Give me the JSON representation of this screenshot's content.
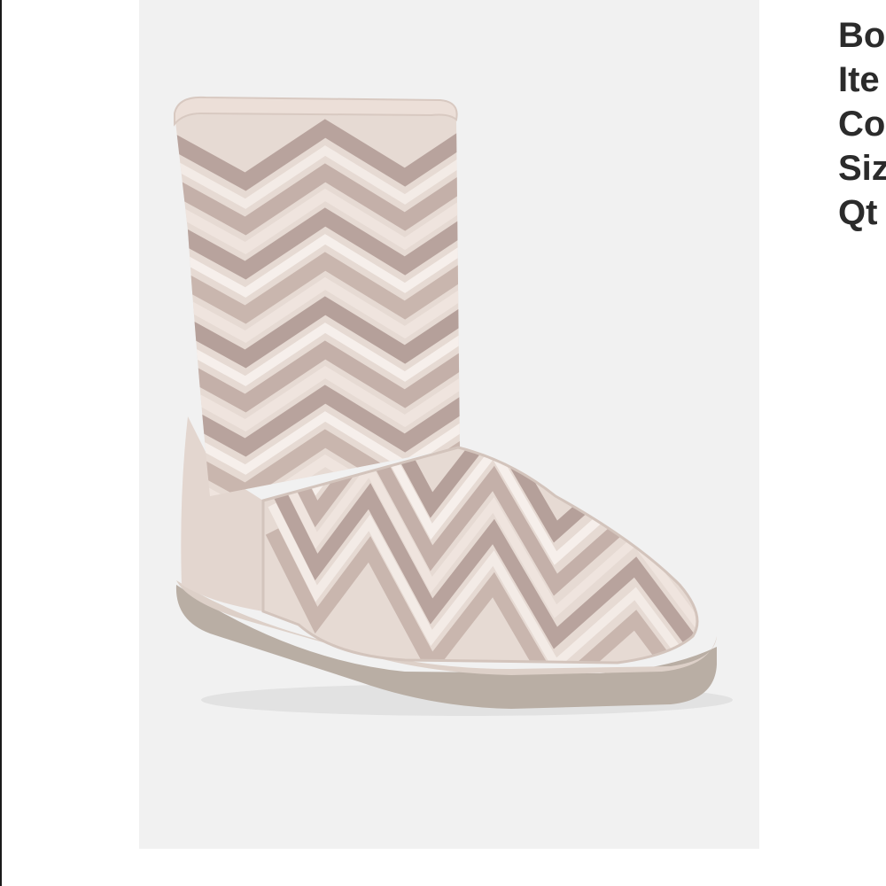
{
  "product": {
    "image_alt": "Sequined chevron boot",
    "colors": {
      "panel_background": "#f1f1f1",
      "boot_base": "#e3d6cf",
      "chevron_dark": "#b8a39d",
      "chevron_mid": "#d9c8c1",
      "chevron_light": "#f3ebe6",
      "sole": "#b9aea4",
      "text": "#2b2b2b"
    }
  },
  "details": {
    "lines": [
      "Bo",
      "Ite",
      "Co",
      "Siz",
      "Qt"
    ]
  }
}
